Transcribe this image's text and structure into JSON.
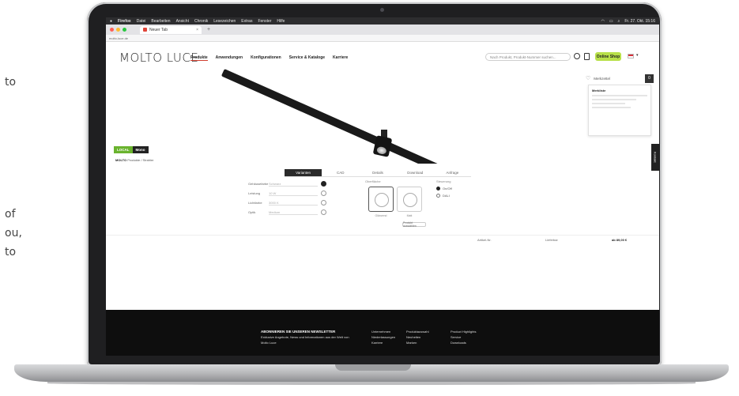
{
  "left_page": {
    "fragments": [
      "to",
      "of",
      "ou,",
      "to"
    ]
  },
  "os": {
    "app": "Firefox",
    "menu": [
      "Datei",
      "Bearbeiten",
      "Ansicht",
      "Chronik",
      "Lesezeichen",
      "Extras",
      "Fenster",
      "Hilfe"
    ],
    "clock": "Fr. 27. Okt. 15:16"
  },
  "browser": {
    "tab_title": "Neuer Tab",
    "url": "molto-luce.de"
  },
  "site": {
    "logo": "MOLTO LUCE",
    "nav": [
      "Produkte",
      "Anwendungen",
      "Konfigurationen",
      "Service & Kataloge",
      "Karriere"
    ],
    "search_placeholder": "Nach Produkt, Produkt-Nummer suchen...",
    "shop_label": "Online Shop"
  },
  "hero": {
    "badge_primary": "LOCAL",
    "badge_secondary": "Mono"
  },
  "panel": {
    "label": "Merkzettel",
    "count": "0",
    "heading": "Merkliste"
  },
  "side_tab": "Kontakt",
  "breadcrumb": {
    "bold": "MOLTO",
    "rest": "Produkte / Strahler"
  },
  "product_tabs": [
    "Varianten",
    "CAD",
    "Details",
    "Download",
    "Anfrage"
  ],
  "config": {
    "rows": [
      {
        "label": "Gehäusefarbe",
        "value": "Schwarz"
      },
      {
        "label": "Leistung",
        "value": "10 W"
      },
      {
        "label": "Lichtfarbe",
        "value": "3000 K"
      },
      {
        "label": "Optik",
        "value": "Medium"
      }
    ],
    "finish_label": "Oberfläche",
    "finishes": [
      "Glänzend",
      "Matt"
    ],
    "radio_label": "Steuerung",
    "radios": [
      "On/Off",
      "DALI"
    ],
    "configure_label": "Produkt auswählen"
  },
  "infobar": {
    "article": "Artikel-Nr.",
    "stock": "Lieferbar",
    "price": "ab 89,00 €"
  },
  "footer": {
    "newsletter_title": "ABONNIEREN SIE UNSEREN NEWSLETTER",
    "newsletter_text": "Exklusive Angebote, News und Informationen aus der Welt von Molto Luce",
    "col1": [
      "Unternehmen",
      "Niederlassungen",
      "Karriere"
    ],
    "col2": [
      "Produktauswahl",
      "Neuheiten",
      "Marken"
    ],
    "col3": [
      "Product Highlights",
      "Service",
      "Downloads"
    ]
  },
  "colors": {
    "accent_green": "#b8e04a",
    "badge_green": "#6ab32e",
    "footer_bg": "#0e0e0e"
  }
}
